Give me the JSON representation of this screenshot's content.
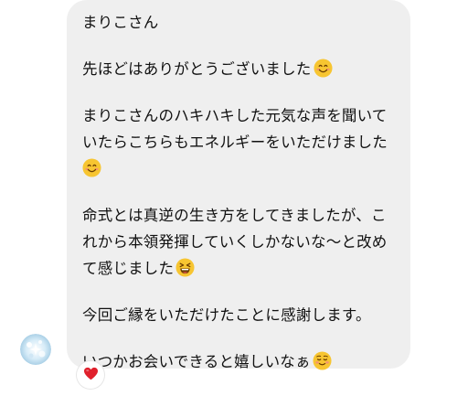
{
  "message": {
    "greeting": "まりこさん",
    "para1": "先ほどはありがとうございました",
    "para2_line1": "まりこさんのハキハキした元気な声を聞いて",
    "para2_line2": "いたらこちらもエネルギーをいただけました",
    "para3_line1": "命式とは真逆の生き方をしてきましたが、こ",
    "para3_line2": "れから本領発揮していくしかないな〜と改め",
    "para3_line3": "て感じました",
    "para4": "今回ご縁をいただけたことに感謝します。",
    "para5": "いつかお会いできると嬉しいなぁ"
  },
  "reaction": {
    "emoji": "heart"
  },
  "colors": {
    "bubble": "#efefef",
    "text": "#111111",
    "emoji_face": "#f7c531",
    "blush": "#f28b7b",
    "heart": "#e0202c"
  }
}
